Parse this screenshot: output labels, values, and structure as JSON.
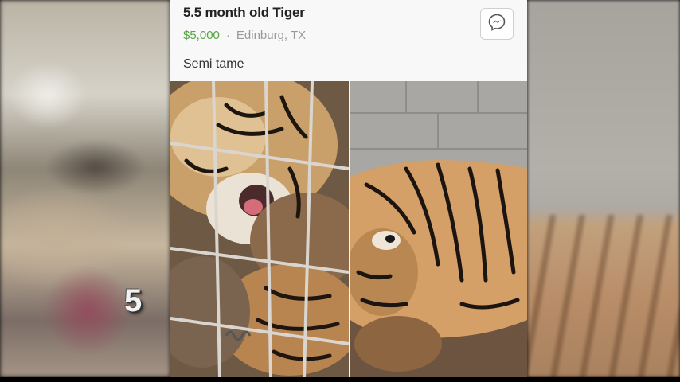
{
  "listing": {
    "title": "5.5 month old Tiger",
    "price": "$5,000",
    "separator": "·",
    "location": "Edinburg, TX",
    "description": "Semi tame"
  },
  "icons": {
    "message": "messenger-icon"
  },
  "photos": [
    {
      "subject": "tiger cub behind cage bars"
    },
    {
      "subject": "tiger cub lying down"
    }
  ],
  "broadcast": {
    "channel_logo_text": "5"
  },
  "colors": {
    "price": "#56a443",
    "card_background": "#f8f8f8"
  }
}
